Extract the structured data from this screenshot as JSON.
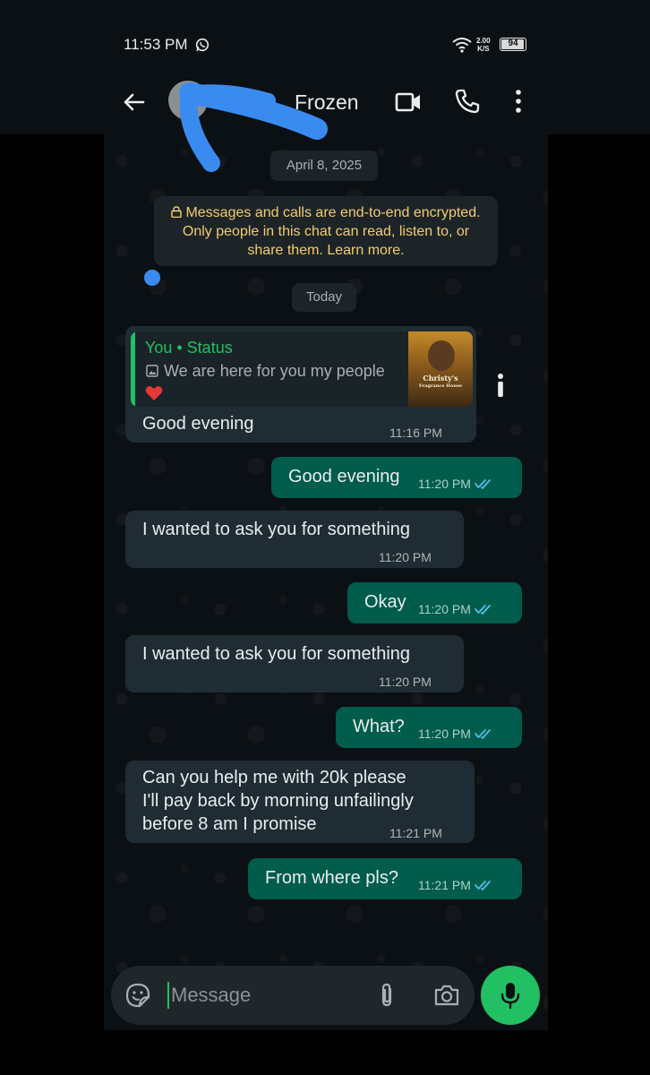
{
  "status_bar": {
    "time": "11:53 PM",
    "speed_value": "2.00",
    "speed_unit": "K/S",
    "battery": "94",
    "icons": [
      "whatsapp-icon",
      "wifi-icon",
      "battery-icon"
    ]
  },
  "header": {
    "contact_name": "Frozen",
    "icons": [
      "back-arrow-icon",
      "video-call-icon",
      "phone-icon",
      "more-options-icon"
    ]
  },
  "chat": {
    "date_chip": "April 8, 2025",
    "encryption_notice": "Messages and calls are end-to-end encrypted. Only people in this chat can read, listen to, or share them. Learn more.",
    "today_chip": "Today",
    "messages": [
      {
        "direction": "in",
        "quote_title": "You • Status",
        "quote_text": "We are here for you my people",
        "quote_thumb_title": "Christy's",
        "quote_thumb_sub": "Fragrance House",
        "text": "Good evening",
        "time": "11:16 PM"
      },
      {
        "direction": "out",
        "text": "Good evening",
        "time": "11:20 PM",
        "read": true
      },
      {
        "direction": "in",
        "text": "I wanted to ask you for something",
        "time": "11:20 PM"
      },
      {
        "direction": "out",
        "text": "Okay",
        "time": "11:20 PM",
        "read": true
      },
      {
        "direction": "in",
        "text": "I wanted to ask you for something",
        "time": "11:20 PM"
      },
      {
        "direction": "out",
        "text": "What?",
        "time": "11:20 PM",
        "read": true
      },
      {
        "direction": "in",
        "lines": [
          "Can you help me with 20k please",
          "I'll pay back by morning unfailingly",
          "before 8 am I promise"
        ],
        "time": "11:21 PM"
      },
      {
        "direction": "out",
        "text": "From where pls?",
        "time": "11:21 PM",
        "read": true
      }
    ]
  },
  "composer": {
    "placeholder": "Message"
  },
  "colors": {
    "background": "#0b1014",
    "incoming_bubble": "#202c33",
    "outgoing_bubble": "#005c4b",
    "accent_green": "#21c063",
    "read_ticks": "#53bdeb",
    "encryption_text": "#f2cd6e",
    "annotation_blue": "#3a8bf0"
  }
}
